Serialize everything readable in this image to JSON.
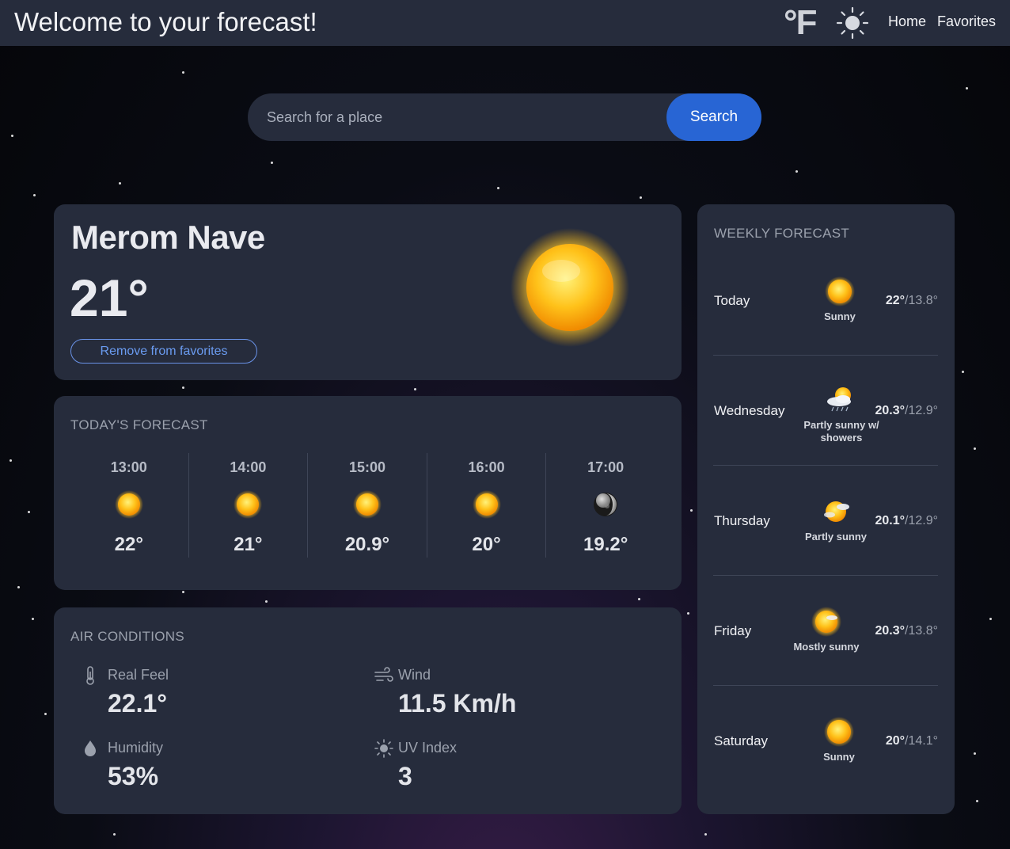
{
  "header": {
    "title": "Welcome to your forecast!",
    "unit_toggle": "°F",
    "theme_icon": "sun-icon",
    "nav": {
      "home": "Home",
      "favorites": "Favorites"
    }
  },
  "search": {
    "placeholder": "Search for a place",
    "value": "",
    "button": "Search"
  },
  "current": {
    "city": "Merom Nave",
    "temperature": "21°",
    "favorite_button": "Remove from favorites",
    "icon": "sun-icon"
  },
  "today": {
    "title": "TODAY'S FORECAST",
    "hours": [
      {
        "time": "13:00",
        "temp": "22°",
        "icon": "sun-icon"
      },
      {
        "time": "14:00",
        "temp": "21°",
        "icon": "sun-icon"
      },
      {
        "time": "15:00",
        "temp": "20.9°",
        "icon": "sun-icon"
      },
      {
        "time": "16:00",
        "temp": "20°",
        "icon": "sun-icon"
      },
      {
        "time": "17:00",
        "temp": "19.2°",
        "icon": "moon-icon"
      }
    ]
  },
  "air": {
    "title": "AIR CONDITIONS",
    "real_feel": {
      "label": "Real Feel",
      "value": "22.1°"
    },
    "wind": {
      "label": "Wind",
      "value": "11.5 Km/h"
    },
    "humidity": {
      "label": "Humidity",
      "value": "53%"
    },
    "uv": {
      "label": "UV Index",
      "value": "3"
    }
  },
  "weekly": {
    "title": "WEEKLY FORECAST",
    "days": [
      {
        "day": "Today",
        "desc": "Sunny",
        "hi": "22°",
        "lo": "/13.8°",
        "icon": "sun-icon"
      },
      {
        "day": "Wednesday",
        "desc": "Partly sunny w/ showers",
        "hi": "20.3°",
        "lo": "/12.9°",
        "icon": "partly-sunny-showers-icon"
      },
      {
        "day": "Thursday",
        "desc": "Partly sunny",
        "hi": "20.1°",
        "lo": "/12.9°",
        "icon": "partly-sunny-icon"
      },
      {
        "day": "Friday",
        "desc": "Mostly sunny",
        "hi": "20.3°",
        "lo": "/13.8°",
        "icon": "mostly-sunny-icon"
      },
      {
        "day": "Saturday",
        "desc": "Sunny",
        "hi": "20°",
        "lo": "/14.1°",
        "icon": "sun-icon"
      }
    ]
  },
  "colors": {
    "card": "#262c3c",
    "accent": "#2865d4",
    "link": "#6a9bf0"
  }
}
